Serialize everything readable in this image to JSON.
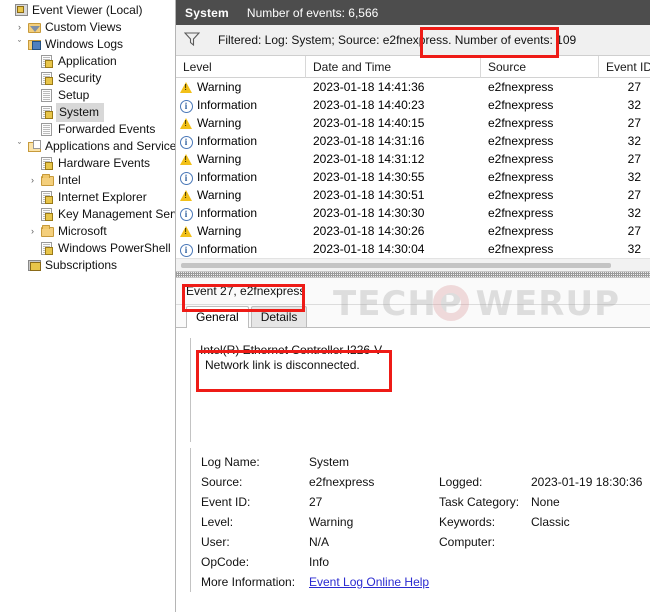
{
  "sidebar": {
    "nodes": [
      {
        "label": "Event Viewer (Local)",
        "icon": "event-viewer-icon",
        "indent": 0,
        "expander": "",
        "selected": false
      },
      {
        "label": "Custom Views",
        "icon": "custom-views-folder-icon",
        "indent": 1,
        "expander": "›",
        "selected": false
      },
      {
        "label": "Windows Logs",
        "icon": "windows-logs-folder-icon",
        "indent": 1,
        "expander": "ˇ",
        "selected": false
      },
      {
        "label": "Application",
        "icon": "log-icon",
        "indent": 2,
        "expander": "",
        "selected": false
      },
      {
        "label": "Security",
        "icon": "log-icon",
        "indent": 2,
        "expander": "",
        "selected": false
      },
      {
        "label": "Setup",
        "icon": "plain-log-icon",
        "indent": 2,
        "expander": "",
        "selected": false
      },
      {
        "label": "System",
        "icon": "log-icon",
        "indent": 2,
        "expander": "",
        "selected": true
      },
      {
        "label": "Forwarded Events",
        "icon": "plain-log-icon",
        "indent": 2,
        "expander": "",
        "selected": false
      },
      {
        "label": "Applications and Services Lo",
        "icon": "apps-services-folder-icon",
        "indent": 1,
        "expander": "ˇ",
        "selected": false
      },
      {
        "label": "Hardware Events",
        "icon": "log-icon",
        "indent": 2,
        "expander": "",
        "selected": false
      },
      {
        "label": "Intel",
        "icon": "folder-icon",
        "indent": 2,
        "expander": "›",
        "selected": false
      },
      {
        "label": "Internet Explorer",
        "icon": "log-icon",
        "indent": 2,
        "expander": "",
        "selected": false
      },
      {
        "label": "Key Management Service",
        "icon": "log-icon",
        "indent": 2,
        "expander": "",
        "selected": false
      },
      {
        "label": "Microsoft",
        "icon": "folder-icon",
        "indent": 2,
        "expander": "›",
        "selected": false
      },
      {
        "label": "Windows PowerShell",
        "icon": "log-icon",
        "indent": 2,
        "expander": "",
        "selected": false
      },
      {
        "label": "Subscriptions",
        "icon": "subscriptions-icon",
        "indent": 1,
        "expander": "",
        "selected": false
      }
    ]
  },
  "header": {
    "title": "System",
    "event_count": "Number of events: 6,566"
  },
  "filter": {
    "icon": "filter-funnel-icon",
    "text": "Filtered: Log: System; Source: e2fnexpress. Number of events: 109"
  },
  "list": {
    "columns": [
      "Level",
      "Date and Time",
      "Source",
      "Event ID"
    ],
    "rows": [
      {
        "level": "Warning",
        "severity": "warn",
        "date": "2023-01-18 14:41:36",
        "source": "e2fnexpress",
        "event_id": "27"
      },
      {
        "level": "Information",
        "severity": "info",
        "date": "2023-01-18 14:40:23",
        "source": "e2fnexpress",
        "event_id": "32"
      },
      {
        "level": "Warning",
        "severity": "warn",
        "date": "2023-01-18 14:40:15",
        "source": "e2fnexpress",
        "event_id": "27"
      },
      {
        "level": "Information",
        "severity": "info",
        "date": "2023-01-18 14:31:16",
        "source": "e2fnexpress",
        "event_id": "32"
      },
      {
        "level": "Warning",
        "severity": "warn",
        "date": "2023-01-18 14:31:12",
        "source": "e2fnexpress",
        "event_id": "27"
      },
      {
        "level": "Information",
        "severity": "info",
        "date": "2023-01-18 14:30:55",
        "source": "e2fnexpress",
        "event_id": "32"
      },
      {
        "level": "Warning",
        "severity": "warn",
        "date": "2023-01-18 14:30:51",
        "source": "e2fnexpress",
        "event_id": "27"
      },
      {
        "level": "Information",
        "severity": "info",
        "date": "2023-01-18 14:30:30",
        "source": "e2fnexpress",
        "event_id": "32"
      },
      {
        "level": "Warning",
        "severity": "warn",
        "date": "2023-01-18 14:30:26",
        "source": "e2fnexpress",
        "event_id": "27"
      },
      {
        "level": "Information",
        "severity": "info",
        "date": "2023-01-18 14:30:04",
        "source": "e2fnexpress",
        "event_id": "32"
      }
    ]
  },
  "detail": {
    "title": "Event 27, e2fnexpress",
    "tabs": [
      {
        "label": "General",
        "active": true
      },
      {
        "label": "Details",
        "active": false
      }
    ],
    "message_line1": "Intel(R) Ethernet Controller I226-V",
    "message_line2": "Network link is disconnected.",
    "properties": {
      "log_name_label": "Log Name:",
      "log_name_value": "System",
      "source_label": "Source:",
      "source_value": "e2fnexpress",
      "logged_label": "Logged:",
      "logged_value": "2023-01-19 18:30:36",
      "event_id_label": "Event ID:",
      "event_id_value": "27",
      "task_category_label": "Task Category:",
      "task_category_value": "None",
      "level_label": "Level:",
      "level_value": "Warning",
      "keywords_label": "Keywords:",
      "keywords_value": "Classic",
      "user_label": "User:",
      "user_value": "N/A",
      "computer_label": "Computer:",
      "computer_value": "",
      "opcode_label": "OpCode:",
      "opcode_value": "Info",
      "more_info_label": "More Information:",
      "more_info_link": "Event Log Online Help"
    }
  },
  "watermark": {
    "text": "TECHP WERUP"
  },
  "colors": {
    "header_bar": "#4d4d4d",
    "annotation": "#ee1b16",
    "warning": "#f2c018",
    "information": "#4a78b8",
    "link": "#2a2ad0"
  }
}
